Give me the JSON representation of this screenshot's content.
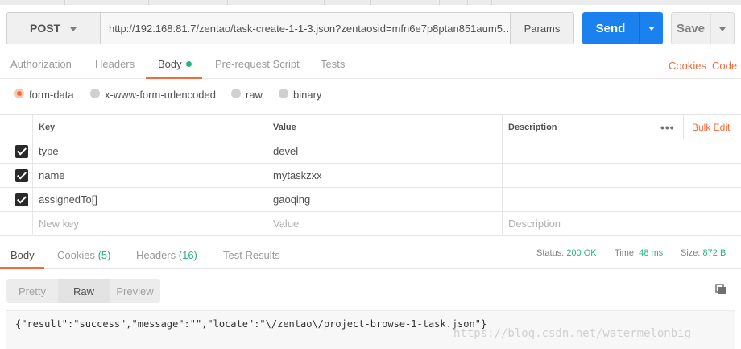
{
  "request": {
    "method": "POST",
    "url": "http://192.168.81.7/zentao/task-create-1-1-3.json?zentaosid=mfn6e7p8ptan851aum5…",
    "params_label": "Params",
    "send_label": "Send",
    "save_label": "Save"
  },
  "request_tabs": [
    {
      "label": "Authorization"
    },
    {
      "label": "Headers"
    },
    {
      "label": "Body",
      "active": true
    },
    {
      "label": "Pre-request Script"
    },
    {
      "label": "Tests"
    }
  ],
  "request_links": {
    "cookies": "Cookies",
    "code": "Code"
  },
  "body_types": [
    {
      "label": "form-data",
      "checked": true
    },
    {
      "label": "x-www-form-urlencoded"
    },
    {
      "label": "raw"
    },
    {
      "label": "binary"
    }
  ],
  "form_table": {
    "headers": {
      "key": "Key",
      "value": "Value",
      "description": "Description"
    },
    "bulk_edit": "Bulk Edit",
    "rows": [
      {
        "key": "type",
        "value": "devel",
        "checked": true
      },
      {
        "key": "name",
        "value": "mytaskzxx",
        "checked": true
      },
      {
        "key": "assignedTo[]",
        "value": "gaoqing",
        "checked": true
      }
    ],
    "new_row": {
      "key": "New key",
      "value": "Value",
      "description": "Description"
    }
  },
  "response_tabs": [
    {
      "label": "Body",
      "active": true
    },
    {
      "label": "Cookies",
      "count": "(5)"
    },
    {
      "label": "Headers",
      "count": "(16)"
    },
    {
      "label": "Test Results"
    }
  ],
  "response_stats": {
    "status_label": "Status:",
    "status_value": "200 OK",
    "time_label": "Time:",
    "time_value": "48 ms",
    "size_label": "Size:",
    "size_value": "872 B"
  },
  "view_modes": [
    "Pretty",
    "Raw",
    "Preview"
  ],
  "response_body": "{\"result\":\"success\",\"message\":\"\",\"locate\":\"\\/zentao\\/project-browse-1-task.json\"}",
  "watermark": "https://blog.csdn.net/watermelonbig",
  "colors": {
    "accent": "#f26b3a",
    "send": "#1a81ee",
    "success": "#26b47f"
  }
}
